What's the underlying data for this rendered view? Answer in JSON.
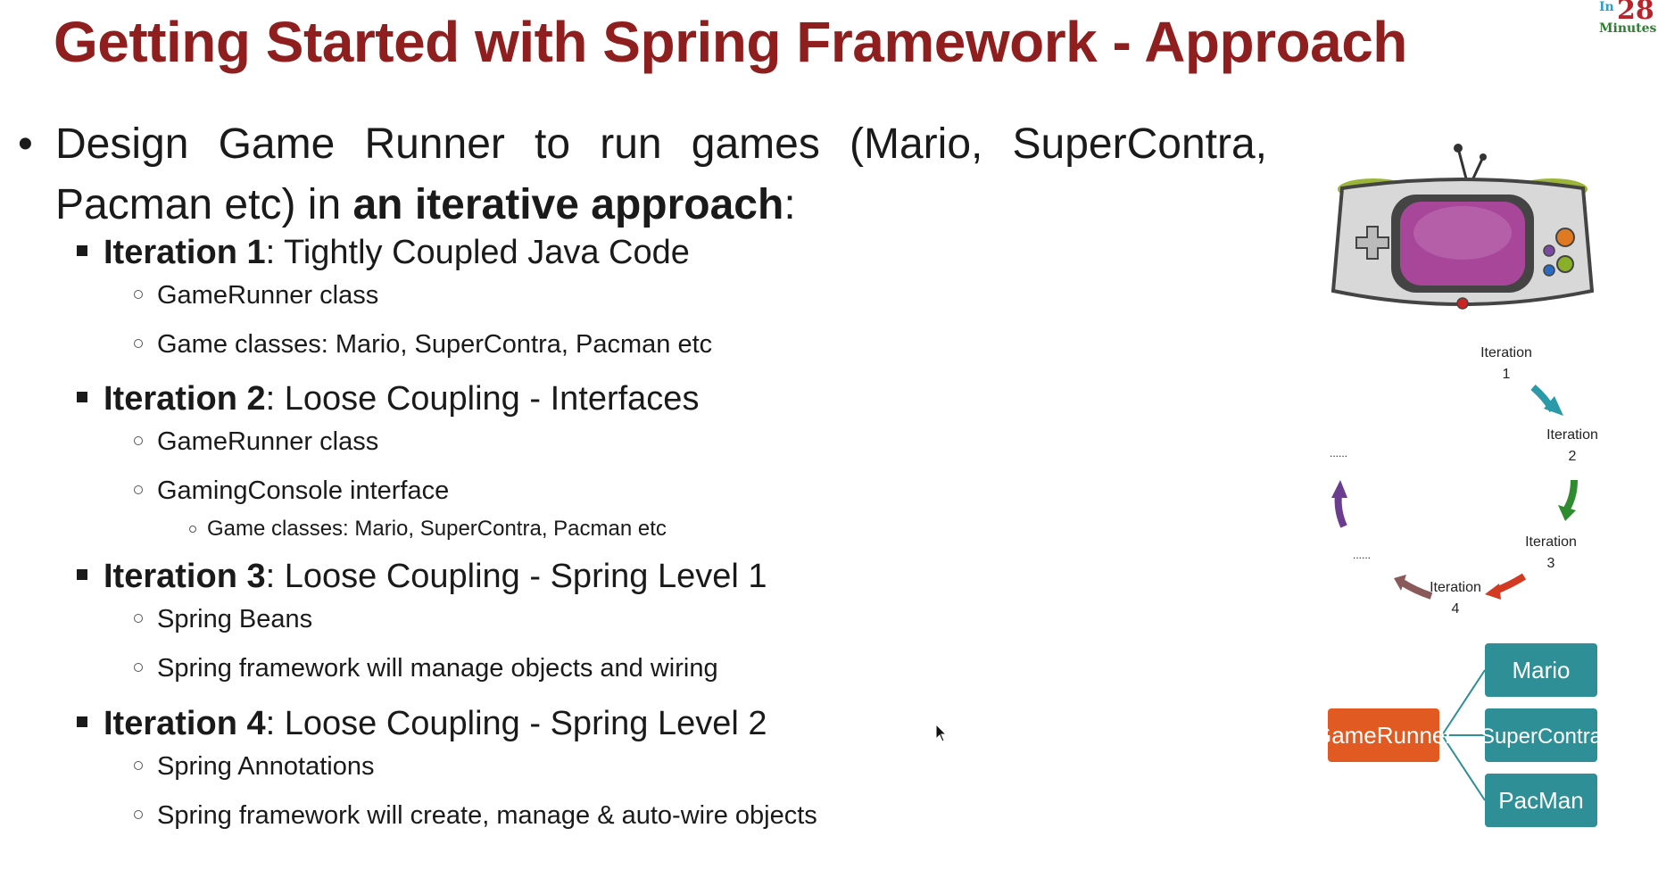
{
  "slide": {
    "title": "Getting Started with Spring Framework - Approach",
    "logo": {
      "in": "In",
      "number": "28",
      "minutes": "Minutes"
    }
  },
  "main_bullet": {
    "text": "Design Game Runner to run games (Mario, SuperContra, Pacman etc) in ",
    "bold": "an iterative approach",
    "suffix": ":"
  },
  "iterations": [
    {
      "label": "Iteration 1",
      "title": ": Tightly Coupled Java Code",
      "items": [
        "GameRunner class",
        "Game classes: Mario, SuperContra, Pacman etc"
      ]
    },
    {
      "label": "Iteration 2",
      "title": ": Loose Coupling - Interfaces",
      "items": [
        "GameRunner class",
        "GamingConsole interface"
      ],
      "subitems": [
        "Game classes: Mario, SuperContra, Pacman etc"
      ]
    },
    {
      "label": "Iteration 3",
      "title": ": Loose Coupling - Spring Level 1",
      "items": [
        "Spring Beans",
        "Spring framework will manage objects and wiring"
      ]
    },
    {
      "label": "Iteration 4",
      "title": ": Loose Coupling - Spring Level 2",
      "items": [
        "Spring Annotations",
        "Spring framework will create, manage & auto-wire objects"
      ]
    }
  ],
  "cycle_diagram": {
    "nodes": [
      {
        "line1": "Iteration",
        "line2": "1"
      },
      {
        "line1": "Iteration",
        "line2": "2"
      },
      {
        "line1": "Iteration",
        "line2": "3"
      },
      {
        "line1": "Iteration",
        "line2": "4"
      }
    ],
    "ellipsis_1": "......",
    "ellipsis_2": "......",
    "arrow_colors": [
      "#2a9aa8",
      "#2e8b2e",
      "#d23a22",
      "#8a5a5a",
      "#6a3d8f"
    ]
  },
  "flow_diagram": {
    "source": "GameRunner",
    "targets": [
      "Mario",
      "SuperContra",
      "PacMan"
    ],
    "source_color": "#e05a22",
    "target_color": "#2f8f96"
  },
  "colors": {
    "title": "#8f1f1f",
    "text": "#1a1a1a"
  }
}
